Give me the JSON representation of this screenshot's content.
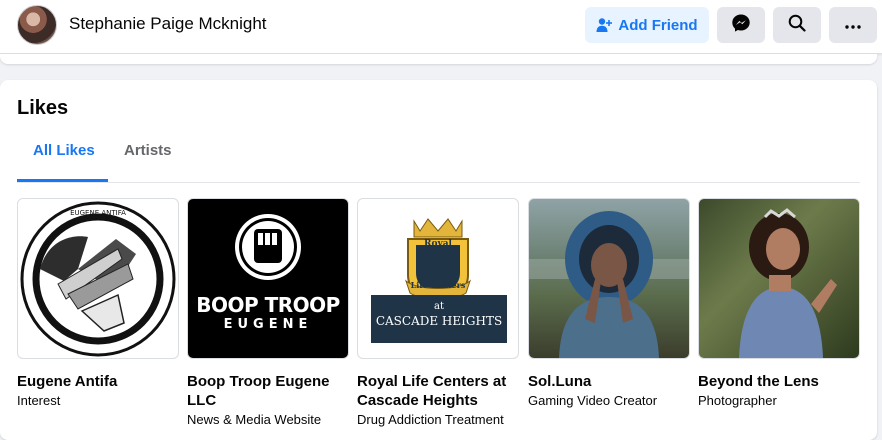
{
  "header": {
    "profile_name": "Stephanie Paige Mcknight",
    "add_friend_label": "Add Friend",
    "icons": [
      "add-person-icon",
      "messenger-icon",
      "search-icon",
      "more-icon"
    ]
  },
  "likes": {
    "title": "Likes",
    "tabs": [
      {
        "label": "All Likes",
        "active": true
      },
      {
        "label": "Artists",
        "active": false
      }
    ],
    "items": [
      {
        "title": "Eugene Antifa",
        "subtitle": "Interest",
        "logo_text": "EUGENE ANTIFA"
      },
      {
        "title": "Boop Troop Eugene LLC",
        "subtitle": "News & Media Website",
        "logo_line1": "BOOP TROOP",
        "logo_line2": "EUGENE"
      },
      {
        "title": "Royal Life Centers at Cascade Heights",
        "subtitle": "Drug Addiction Treatment",
        "logo_top": "Royal",
        "logo_mid": "Life Centers",
        "logo_at": "at",
        "logo_bottom": "CASCADE HEIGHTS"
      },
      {
        "title": "Sol.Luna",
        "subtitle": "Gaming Video Creator"
      },
      {
        "title": "Beyond the Lens",
        "subtitle": "Photographer"
      }
    ]
  },
  "colors": {
    "accent": "#1877f2",
    "add_friend_bg": "#e7f3ff",
    "button_bg": "#e4e6eb",
    "page_bg": "#f0f2f5"
  }
}
